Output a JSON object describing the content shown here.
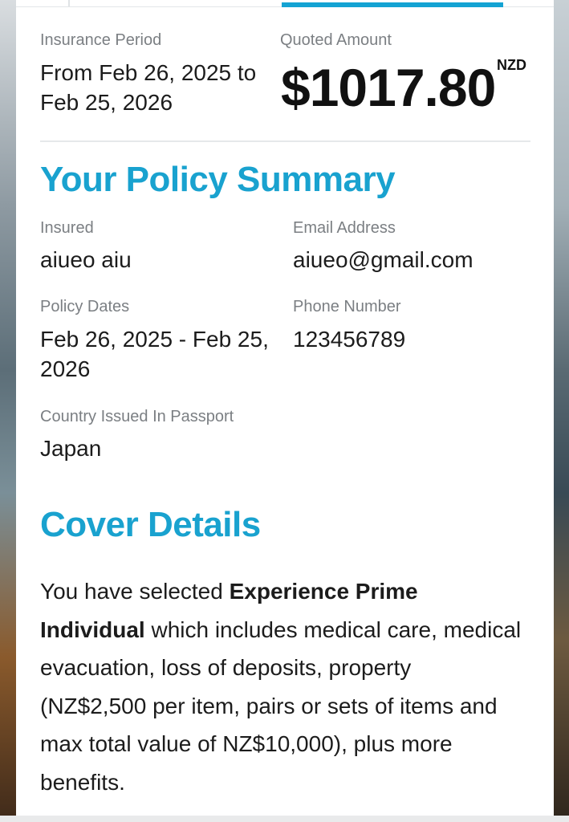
{
  "header": {
    "period_label": "Insurance Period",
    "period_value": "From Feb 26, 2025 to Feb 25, 2026",
    "amount_label": "Quoted Amount",
    "amount_value": "$1017.80",
    "currency": "NZD"
  },
  "summary": {
    "title": "Your Policy Summary",
    "insured_label": "Insured",
    "insured_value": "aiueo aiu",
    "email_label": "Email Address",
    "email_value": "aiueo@gmail.com",
    "dates_label": "Policy Dates",
    "dates_value": "Feb 26, 2025 - Feb 25, 2026",
    "phone_label": "Phone Number",
    "phone_value": "123456789",
    "country_label": "Country Issued In Passport",
    "country_value": "Japan"
  },
  "cover": {
    "title": "Cover Details",
    "text_before": "You have selected ",
    "plan_name": "Experience Prime Individual",
    "text_after": " which includes medical care, medical evacuation, loss of deposits, property (NZ$2,500 per item, pairs or sets of items and max total value of NZ$10,000), plus more benefits."
  }
}
